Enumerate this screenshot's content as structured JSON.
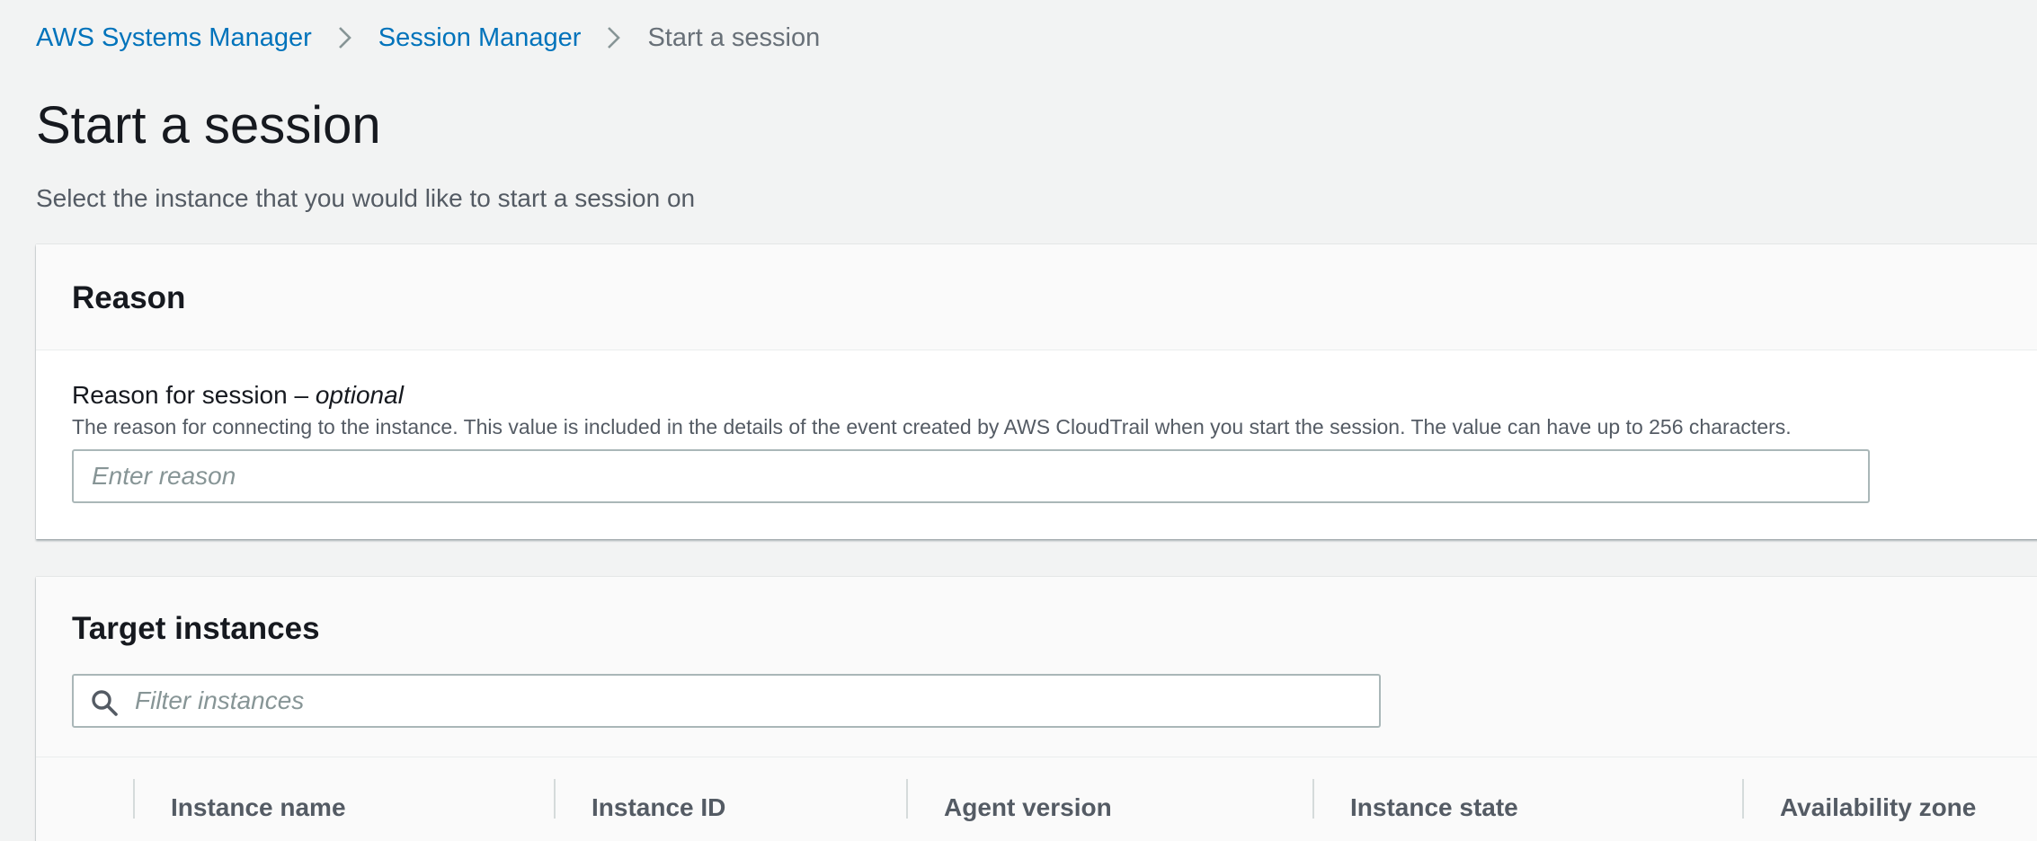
{
  "breadcrumb": {
    "items": [
      {
        "label": "AWS Systems Manager"
      },
      {
        "label": "Session Manager"
      },
      {
        "label": "Start a session"
      }
    ]
  },
  "header": {
    "title": "Start a session",
    "description": "Select the instance that you would like to start a session on"
  },
  "reason_panel": {
    "title": "Reason",
    "field_label": "Reason for session –",
    "field_label_optional": "optional",
    "field_description": "The reason for connecting to the instance. This value is included in the details of the event created by AWS CloudTrail when you start the session. The value can have up to 256 characters.",
    "input_value": "",
    "input_placeholder": "Enter reason"
  },
  "targets_panel": {
    "title": "Target instances",
    "filter_placeholder": "Filter instances",
    "columns": [
      {
        "label": "Instance name"
      },
      {
        "label": "Instance ID"
      },
      {
        "label": "Agent version"
      },
      {
        "label": "Instance state"
      },
      {
        "label": "Availability zone"
      }
    ]
  },
  "icons": {
    "breadcrumb_separator": "chevron-right-icon",
    "filter": "search-icon"
  },
  "colors": {
    "link": "#0073bb",
    "background": "#f2f3f3",
    "panel_header": "#fafafa",
    "text": "#16191f",
    "muted_text": "#545b64"
  }
}
